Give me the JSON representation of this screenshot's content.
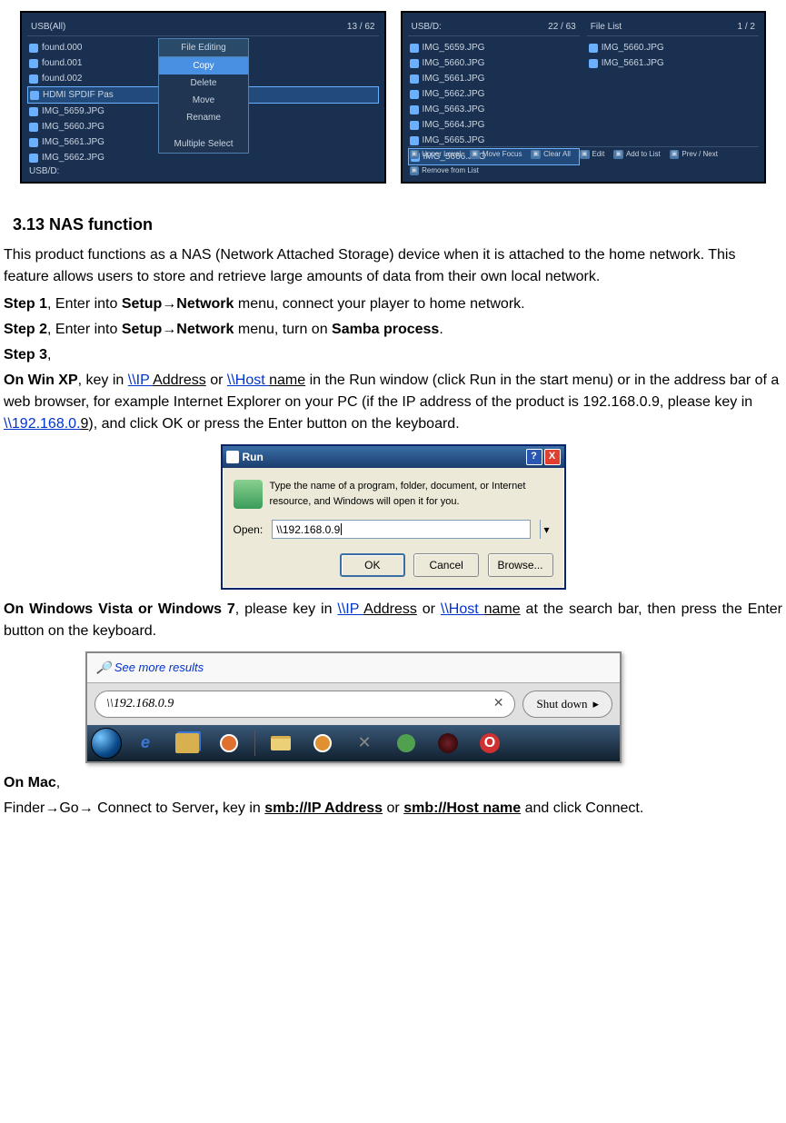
{
  "shot1": {
    "header_left": "USB(All)",
    "header_right": "13 / 62",
    "files": [
      "found.000",
      "found.001",
      "found.002",
      "HDMI SPDIF Pas",
      "IMG_5659.JPG",
      "IMG_5660.JPG",
      "IMG_5661.JPG",
      "IMG_5662.JPG"
    ],
    "selected_index": 3,
    "footer": "USB/D:",
    "menu_title": "File Editing",
    "menu_items": [
      "Copy",
      "Delete",
      "Move",
      "Rename",
      "",
      "Multiple Select"
    ],
    "menu_highlight": 0
  },
  "shot2": {
    "col1_header_left": "USB/D:",
    "col1_header_right": "22 / 63",
    "col2_header_left": "File List",
    "col2_header_right": "1 / 2",
    "col1_files": [
      "IMG_5659.JPG",
      "IMG_5660.JPG",
      "IMG_5661.JPG",
      "IMG_5662.JPG",
      "IMG_5663.JPG",
      "IMG_5664.JPG",
      "IMG_5665.JPG",
      "IMG_5666.JPG"
    ],
    "col1_selected": 7,
    "col2_files": [
      "IMG_5660.JPG",
      "IMG_5661.JPG"
    ],
    "footer_items": [
      "Upper Level",
      "Move Focus",
      "Clear All",
      "Edit",
      "Add to List",
      "Prev / Next",
      "Remove from List"
    ]
  },
  "doc": {
    "heading": "3.13 NAS function",
    "p1": "This product functions as a NAS (Network Attached Storage) device when it is attached to the home network. This feature allows users to store and retrieve large amounts of data from their own local network.",
    "step1_pre": "Step 1",
    "step1_rest": ", Enter into ",
    "setup": "Setup",
    "arrow": "→",
    "network": "Network",
    "step1_tail": " menu, connect your player to home network.",
    "step2_pre": "Step 2",
    "step2_rest": ", Enter into ",
    "step2_mid": " menu, turn on ",
    "samba": "Samba process",
    "step3_pre": "Step 3",
    "winxp_lead": "On Win XP",
    "winxp_1": ", key in ",
    "link_ip": "\\\\IP ",
    "address": "Address",
    "or": " or ",
    "link_host": "\\\\Host ",
    "name": "name",
    "winxp_2": " in the Run window (click Run in the start menu) or in the address bar of a web browser, for example Internet Explorer on your PC (if the IP address of the product is 192.168.0.9, please key in ",
    "link_ip9": "\\\\192.168.0.",
    "nine": "9",
    "winxp_3": "), and click OK or press the Enter button on the keyboard.",
    "vista_lead": "On Windows Vista or Windows 7",
    "vista_1": ", please key in ",
    "vista_2": " at the search bar, then press the Enter button on the keyboard.",
    "mac_lead": "On Mac",
    "mac_1": "Finder",
    "mac_2": "Go",
    "mac_3": " Connect to Server",
    "mac_4": " key in ",
    "smb_ip": "smb://IP Address",
    "smb_host": "smb://Host name",
    "mac_5": " and click Connect."
  },
  "run": {
    "title": "Run",
    "desc": "Type the name of a program, folder, document, or Internet resource, and Windows will open it for you.",
    "open_label": "Open:",
    "value": "\\\\192.168.0.9",
    "ok": "OK",
    "cancel": "Cancel",
    "browse": "Browse..."
  },
  "vista": {
    "more": "See more results",
    "search": "\\\\192.168.0.9",
    "shut": "Shut down"
  }
}
